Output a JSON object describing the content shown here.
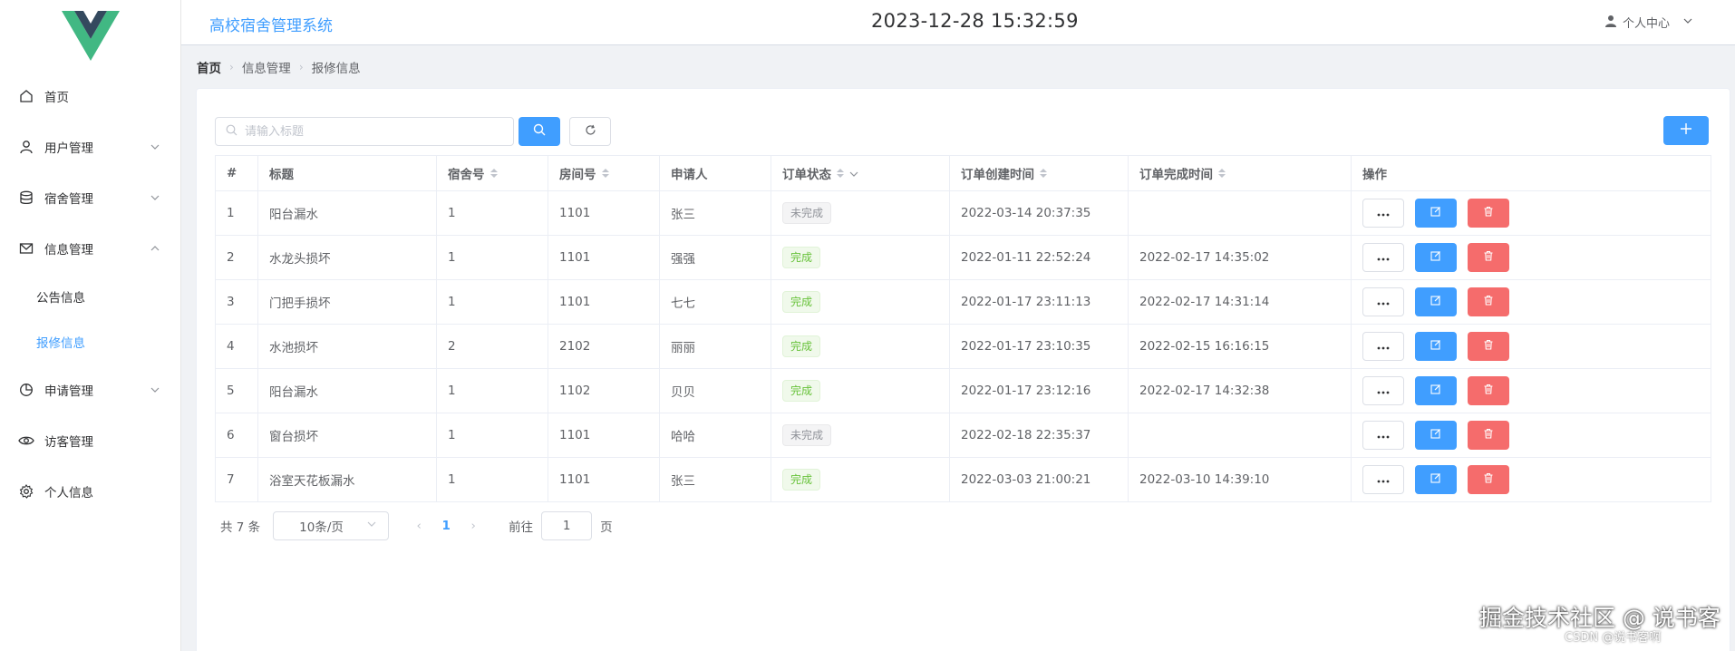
{
  "header": {
    "app_title": "高校宿舍管理系统",
    "datetime": "2023-12-28 15:32:59",
    "user_center": "个人中心"
  },
  "sidebar": {
    "items": [
      {
        "label": "首页",
        "icon": "home-icon"
      },
      {
        "label": "用户管理",
        "icon": "user-icon",
        "expandable": true
      },
      {
        "label": "宿舍管理",
        "icon": "database-icon",
        "expandable": true
      },
      {
        "label": "信息管理",
        "icon": "message-icon",
        "expandable": true,
        "expanded": true
      },
      {
        "label": "申请管理",
        "icon": "pie-chart-icon",
        "expandable": true
      },
      {
        "label": "访客管理",
        "icon": "eye-icon"
      },
      {
        "label": "个人信息",
        "icon": "settings-icon"
      }
    ],
    "submenu": [
      {
        "label": "公告信息",
        "active": false
      },
      {
        "label": "报修信息",
        "active": true
      }
    ]
  },
  "breadcrumb": [
    "首页",
    "信息管理",
    "报修信息"
  ],
  "toolbar": {
    "search_placeholder": "请输入标题"
  },
  "table": {
    "columns": [
      "#",
      "标题",
      "宿舍号",
      "房间号",
      "申请人",
      "订单状态",
      "订单创建时间",
      "订单完成时间",
      "操作"
    ],
    "rows": [
      {
        "idx": "1",
        "title": "阳台漏水",
        "dorm": "1",
        "room": "1101",
        "applicant": "张三",
        "status": "未完成",
        "done": false,
        "created": "2022-03-14 20:37:35",
        "finished": ""
      },
      {
        "idx": "2",
        "title": "水龙头损坏",
        "dorm": "1",
        "room": "1101",
        "applicant": "强强",
        "status": "完成",
        "done": true,
        "created": "2022-01-11 22:52:24",
        "finished": "2022-02-17 14:35:02"
      },
      {
        "idx": "3",
        "title": "门把手损坏",
        "dorm": "1",
        "room": "1101",
        "applicant": "七七",
        "status": "完成",
        "done": true,
        "created": "2022-01-17 23:11:13",
        "finished": "2022-02-17 14:31:14"
      },
      {
        "idx": "4",
        "title": "水池损坏",
        "dorm": "2",
        "room": "2102",
        "applicant": "丽丽",
        "status": "完成",
        "done": true,
        "created": "2022-01-17 23:10:35",
        "finished": "2022-02-15 16:16:15"
      },
      {
        "idx": "5",
        "title": "阳台漏水",
        "dorm": "1",
        "room": "1102",
        "applicant": "贝贝",
        "status": "完成",
        "done": true,
        "created": "2022-01-17 23:12:16",
        "finished": "2022-02-17 14:32:38"
      },
      {
        "idx": "6",
        "title": "窗台损坏",
        "dorm": "1",
        "room": "1101",
        "applicant": "哈哈",
        "status": "未完成",
        "done": false,
        "created": "2022-02-18 22:35:37",
        "finished": ""
      },
      {
        "idx": "7",
        "title": "浴室天花板漏水",
        "dorm": "1",
        "room": "1101",
        "applicant": "张三",
        "status": "完成",
        "done": true,
        "created": "2022-03-03 21:00:21",
        "finished": "2022-03-10 14:39:10"
      }
    ]
  },
  "pagination": {
    "total_text": "共 7 条",
    "page_size": "10条/页",
    "current_page": "1",
    "goto_label": "前往",
    "goto_value": "1",
    "page_suffix": "页"
  },
  "watermark": {
    "line1": "掘金技术社区 @ 说书客",
    "line2": "CSDN @说书客啊"
  },
  "colors": {
    "primary": "#409eff",
    "danger": "#f56c6c",
    "success": "#67c23a",
    "logo_outer": "#41b883",
    "logo_inner": "#34495e"
  }
}
